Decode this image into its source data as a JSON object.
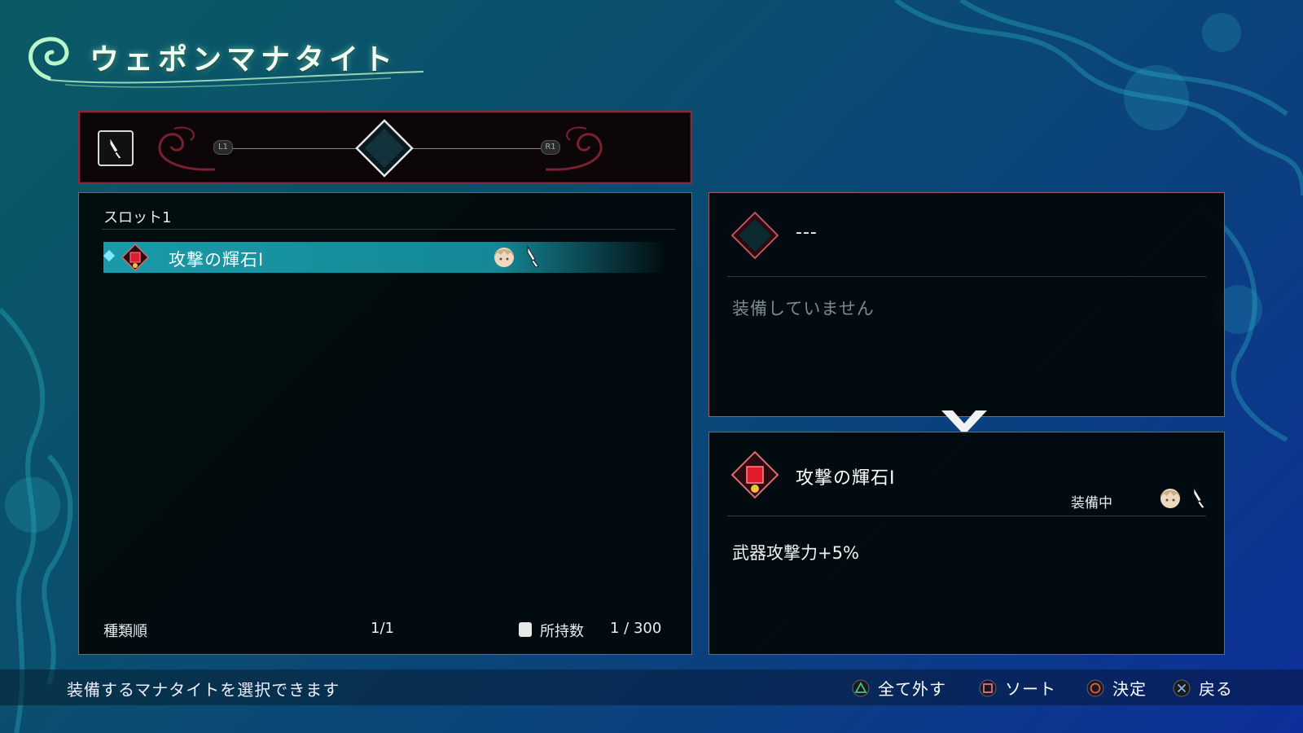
{
  "title": "ウェポンマナタイト",
  "weapon_bar": {
    "left_button": "L1",
    "right_button": "R1"
  },
  "list": {
    "slot_label": "スロット1",
    "items": [
      {
        "name": "攻撃の輝石Ⅰ",
        "gem_color": "#e01b2e",
        "selected": true
      }
    ],
    "sort_label": "種類順",
    "page_counter": "1/1",
    "owned_label": "所持数",
    "owned_count": "1 / 300"
  },
  "current": {
    "name": "---",
    "status": "装備していません"
  },
  "compare": {
    "name": "攻撃の輝石Ⅰ",
    "equipped_tag": "装備中",
    "effect": "武器攻撃力+5%"
  },
  "footer": {
    "hint": "装備するマナタイトを選択できます",
    "buttons": [
      {
        "icon": "triangle-button-icon",
        "label": "全て外す",
        "color": "#3fc29a"
      },
      {
        "icon": "square-button-icon",
        "label": "ソート",
        "color": "#e86aa6"
      },
      {
        "icon": "circle-button-icon",
        "label": "決定",
        "color": "#e8585a"
      },
      {
        "icon": "cross-button-icon",
        "label": "戻る",
        "color": "#7fb6e8"
      }
    ]
  },
  "colors": {
    "accent_teal": "#1a9aa8",
    "frame_red": "#8a2a38",
    "gem_red": "#e01b2e"
  }
}
